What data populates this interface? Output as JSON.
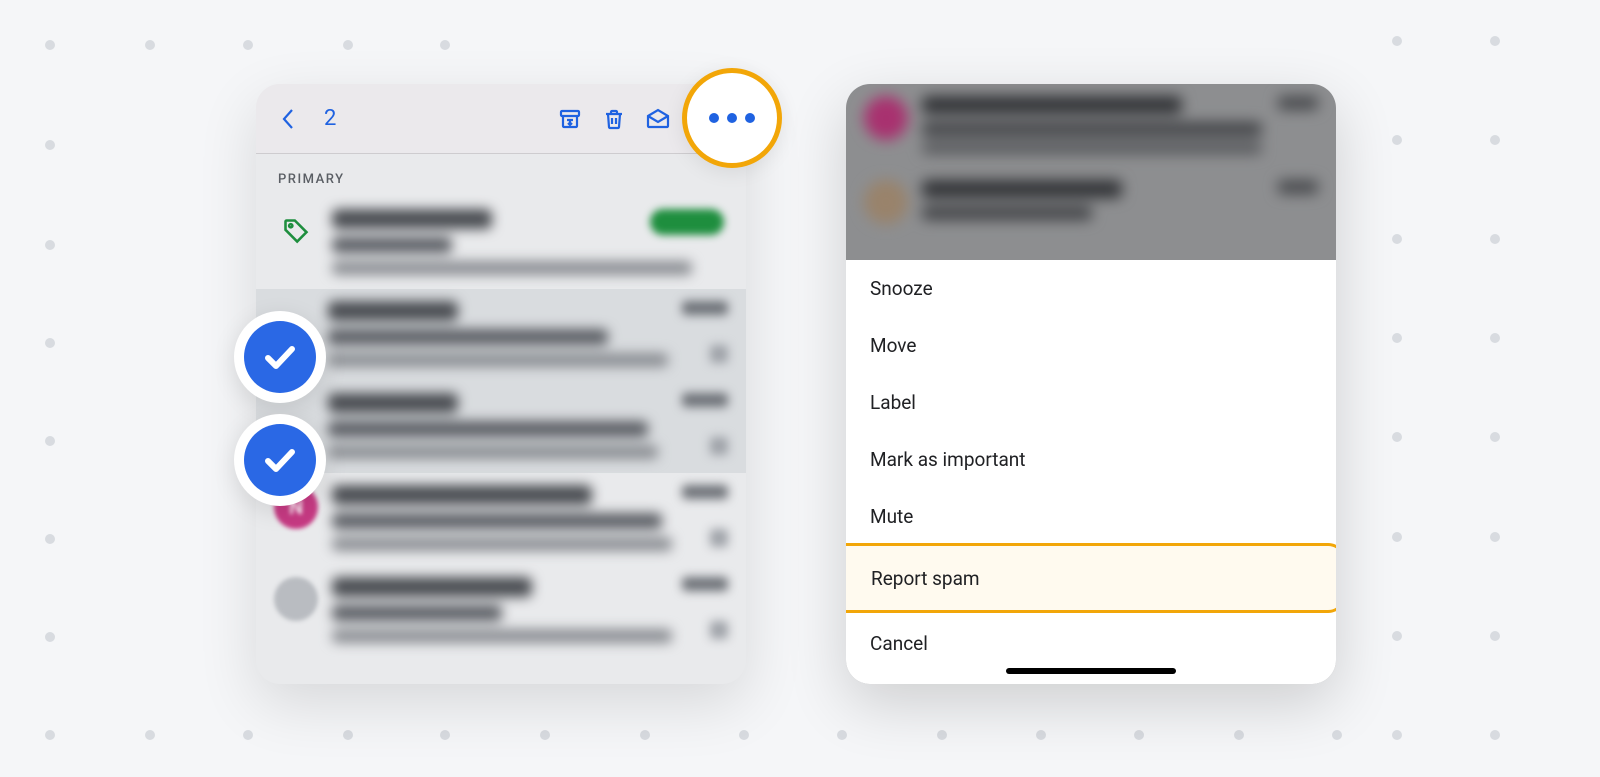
{
  "left": {
    "selected_count": "2",
    "section": "PRIMARY",
    "avatar_letter": "N"
  },
  "sheet": {
    "snooze": "Snooze",
    "move": "Move",
    "label": "Label",
    "mark_important": "Mark as important",
    "mute": "Mute",
    "report_spam": "Report spam",
    "cancel": "Cancel"
  }
}
